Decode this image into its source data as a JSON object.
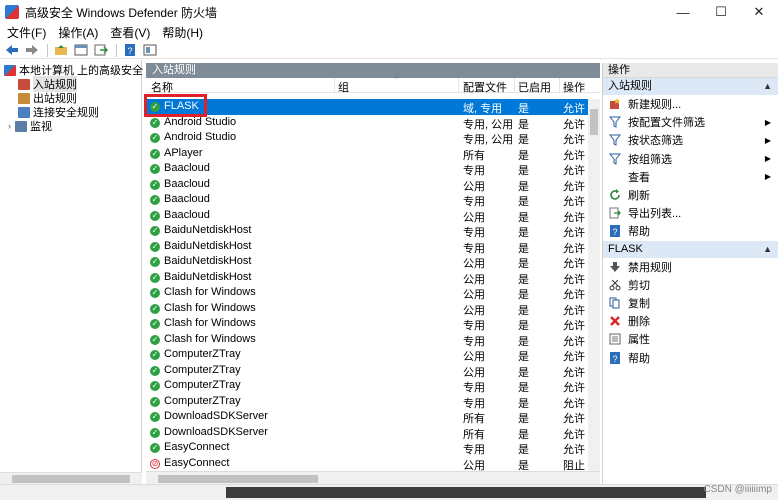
{
  "window": {
    "title": "高级安全 Windows Defender 防火墙",
    "minimize": "—",
    "maximize": "☐",
    "close": "✕"
  },
  "menu": [
    "文件(F)",
    "操作(A)",
    "查看(V)",
    "帮助(H)"
  ],
  "toolbar": {
    "icons": [
      "back-icon",
      "forward-icon",
      "up-folder-icon",
      "show-hide-tree-icon",
      "export-icon",
      "help-icon",
      "properties-icon"
    ]
  },
  "tree": {
    "root": "本地计算机 上的高级安全 Wind",
    "items": [
      "入站规则",
      "出站规则",
      "连接安全规则",
      "监视"
    ]
  },
  "center": {
    "title": "入站规则",
    "columns": [
      "名称",
      "组",
      "配置文件",
      "已启用",
      "操作"
    ],
    "rows": [
      {
        "name": "FLASK",
        "profile": "域, 专用",
        "enabled": "是",
        "action": "允许",
        "status": "allow"
      },
      {
        "name": "Android Studio",
        "profile": "专用, 公用",
        "enabled": "是",
        "action": "允许",
        "status": "allow"
      },
      {
        "name": "Android Studio",
        "profile": "专用, 公用",
        "enabled": "是",
        "action": "允许",
        "status": "allow"
      },
      {
        "name": "APlayer",
        "profile": "所有",
        "enabled": "是",
        "action": "允许",
        "status": "allow"
      },
      {
        "name": "Baacloud",
        "profile": "专用",
        "enabled": "是",
        "action": "允许",
        "status": "allow"
      },
      {
        "name": "Baacloud",
        "profile": "公用",
        "enabled": "是",
        "action": "允许",
        "status": "allow"
      },
      {
        "name": "Baacloud",
        "profile": "专用",
        "enabled": "是",
        "action": "允许",
        "status": "allow"
      },
      {
        "name": "Baacloud",
        "profile": "公用",
        "enabled": "是",
        "action": "允许",
        "status": "allow"
      },
      {
        "name": "BaiduNetdiskHost",
        "profile": "专用",
        "enabled": "是",
        "action": "允许",
        "status": "allow"
      },
      {
        "name": "BaiduNetdiskHost",
        "profile": "专用",
        "enabled": "是",
        "action": "允许",
        "status": "allow"
      },
      {
        "name": "BaiduNetdiskHost",
        "profile": "公用",
        "enabled": "是",
        "action": "允许",
        "status": "allow"
      },
      {
        "name": "BaiduNetdiskHost",
        "profile": "公用",
        "enabled": "是",
        "action": "允许",
        "status": "allow"
      },
      {
        "name": "Clash for Windows",
        "profile": "公用",
        "enabled": "是",
        "action": "允许",
        "status": "allow"
      },
      {
        "name": "Clash for Windows",
        "profile": "公用",
        "enabled": "是",
        "action": "允许",
        "status": "allow"
      },
      {
        "name": "Clash for Windows",
        "profile": "专用",
        "enabled": "是",
        "action": "允许",
        "status": "allow"
      },
      {
        "name": "Clash for Windows",
        "profile": "专用",
        "enabled": "是",
        "action": "允许",
        "status": "allow"
      },
      {
        "name": "ComputerZTray",
        "profile": "公用",
        "enabled": "是",
        "action": "允许",
        "status": "allow"
      },
      {
        "name": "ComputerZTray",
        "profile": "公用",
        "enabled": "是",
        "action": "允许",
        "status": "allow"
      },
      {
        "name": "ComputerZTray",
        "profile": "专用",
        "enabled": "是",
        "action": "允许",
        "status": "allow"
      },
      {
        "name": "ComputerZTray",
        "profile": "专用",
        "enabled": "是",
        "action": "允许",
        "status": "allow"
      },
      {
        "name": "DownloadSDKServer",
        "profile": "所有",
        "enabled": "是",
        "action": "允许",
        "status": "allow"
      },
      {
        "name": "DownloadSDKServer",
        "profile": "所有",
        "enabled": "是",
        "action": "允许",
        "status": "allow"
      },
      {
        "name": "EasyConnect",
        "profile": "专用",
        "enabled": "是",
        "action": "允许",
        "status": "allow"
      },
      {
        "name": "EasyConnect",
        "profile": "公用",
        "enabled": "是",
        "action": "阻止",
        "status": "block"
      }
    ]
  },
  "actions": {
    "title": "操作",
    "section1": "入站规则",
    "section1_items": [
      {
        "label": "新建规则...",
        "icon": "new-rule-icon",
        "submenu": false
      },
      {
        "label": "按配置文件筛选",
        "icon": "filter-icon",
        "submenu": true
      },
      {
        "label": "按状态筛选",
        "icon": "filter-icon",
        "submenu": true
      },
      {
        "label": "按组筛选",
        "icon": "filter-icon",
        "submenu": true
      },
      {
        "label": "查看",
        "icon": "",
        "submenu": true
      },
      {
        "label": "刷新",
        "icon": "refresh-icon",
        "submenu": false
      },
      {
        "label": "导出列表...",
        "icon": "export-list-icon",
        "submenu": false
      },
      {
        "label": "帮助",
        "icon": "help-icon",
        "submenu": false
      }
    ],
    "section2": "FLASK",
    "section2_items": [
      {
        "label": "禁用规则",
        "icon": "disable-rule-icon"
      },
      {
        "label": "剪切",
        "icon": "cut-icon"
      },
      {
        "label": "复制",
        "icon": "copy-icon"
      },
      {
        "label": "删除",
        "icon": "delete-icon"
      },
      {
        "label": "属性",
        "icon": "properties-icon"
      },
      {
        "label": "帮助",
        "icon": "help-icon"
      }
    ]
  },
  "watermark": "CSDN @iiiiiimp"
}
